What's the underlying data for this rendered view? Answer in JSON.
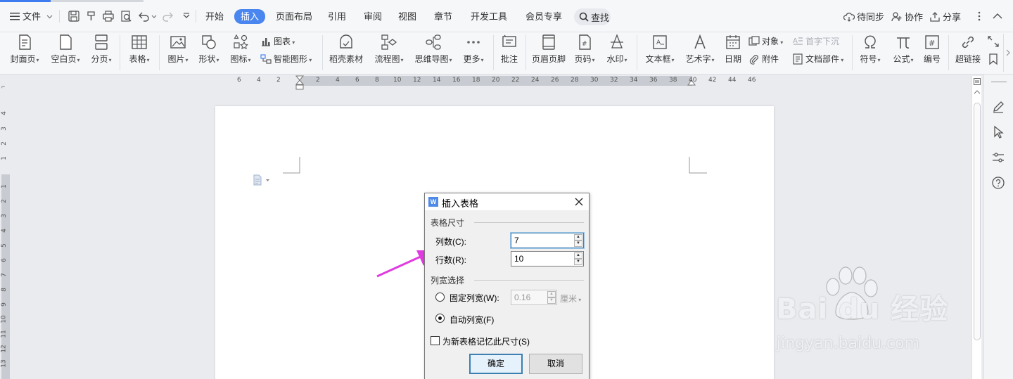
{
  "menu": {
    "file": "文件",
    "tabs": [
      "开始",
      "插入",
      "页面布局",
      "引用",
      "审阅",
      "视图",
      "章节",
      "开发工具",
      "会员专享"
    ],
    "active_tab": "插入",
    "search": "查找",
    "sync": "待同步",
    "collab": "协作",
    "share": "分享"
  },
  "ribbon": {
    "cover": "封面页",
    "blank": "空白页",
    "pagebreak": "分页",
    "table": "表格",
    "picture": "图片",
    "shape": "形状",
    "icon": "图标",
    "chart": "图表",
    "smartart": "智能图形",
    "material": "稻壳素材",
    "flowchart": "流程图",
    "mindmap": "思维导图",
    "more": "更多",
    "comment": "批注",
    "headerfooter": "页眉页脚",
    "pagenum": "页码",
    "watermark": "水印",
    "textbox": "文本框",
    "wordart": "艺术字",
    "date": "日期",
    "object": "对象",
    "attachment": "附件",
    "dropcap": "首字下沉",
    "docpart": "文档部件",
    "symbol": "符号",
    "formula": "公式",
    "numbering": "编号",
    "hyperlink": "超链接"
  },
  "ruler": {
    "h_ticks": [
      "6",
      "4",
      "2",
      "2",
      "4",
      "6",
      "8",
      "10",
      "12",
      "14",
      "16",
      "18",
      "20",
      "22",
      "24",
      "26",
      "28",
      "30",
      "32",
      "34",
      "36",
      "38",
      "40",
      "42",
      "44",
      "46"
    ],
    "v_ticks_top": [
      "4",
      "3",
      "2",
      "1"
    ],
    "v_ticks": [
      "1",
      "2",
      "3",
      "4",
      "5",
      "6",
      "7",
      "8",
      "9",
      "10",
      "11",
      "12",
      "13"
    ]
  },
  "dialog": {
    "title": "插入表格",
    "size_group": "表格尺寸",
    "cols_label": "列数(C):",
    "cols_value": "7",
    "rows_label": "行数(R):",
    "rows_value": "10",
    "width_group": "列宽选择",
    "fixed_label": "固定列宽(W):",
    "fixed_value": "0.16",
    "unit": "厘米",
    "auto_label": "自动列宽(F)",
    "remember_label": "为新表格记忆此尺寸(S)",
    "ok": "确定",
    "cancel": "取消"
  },
  "watermark": {
    "brand": "Bai du 经验",
    "url": "jingyan.baidu.com"
  },
  "colors": {
    "accent": "#4a86f0",
    "arrow": "#e03be0"
  }
}
